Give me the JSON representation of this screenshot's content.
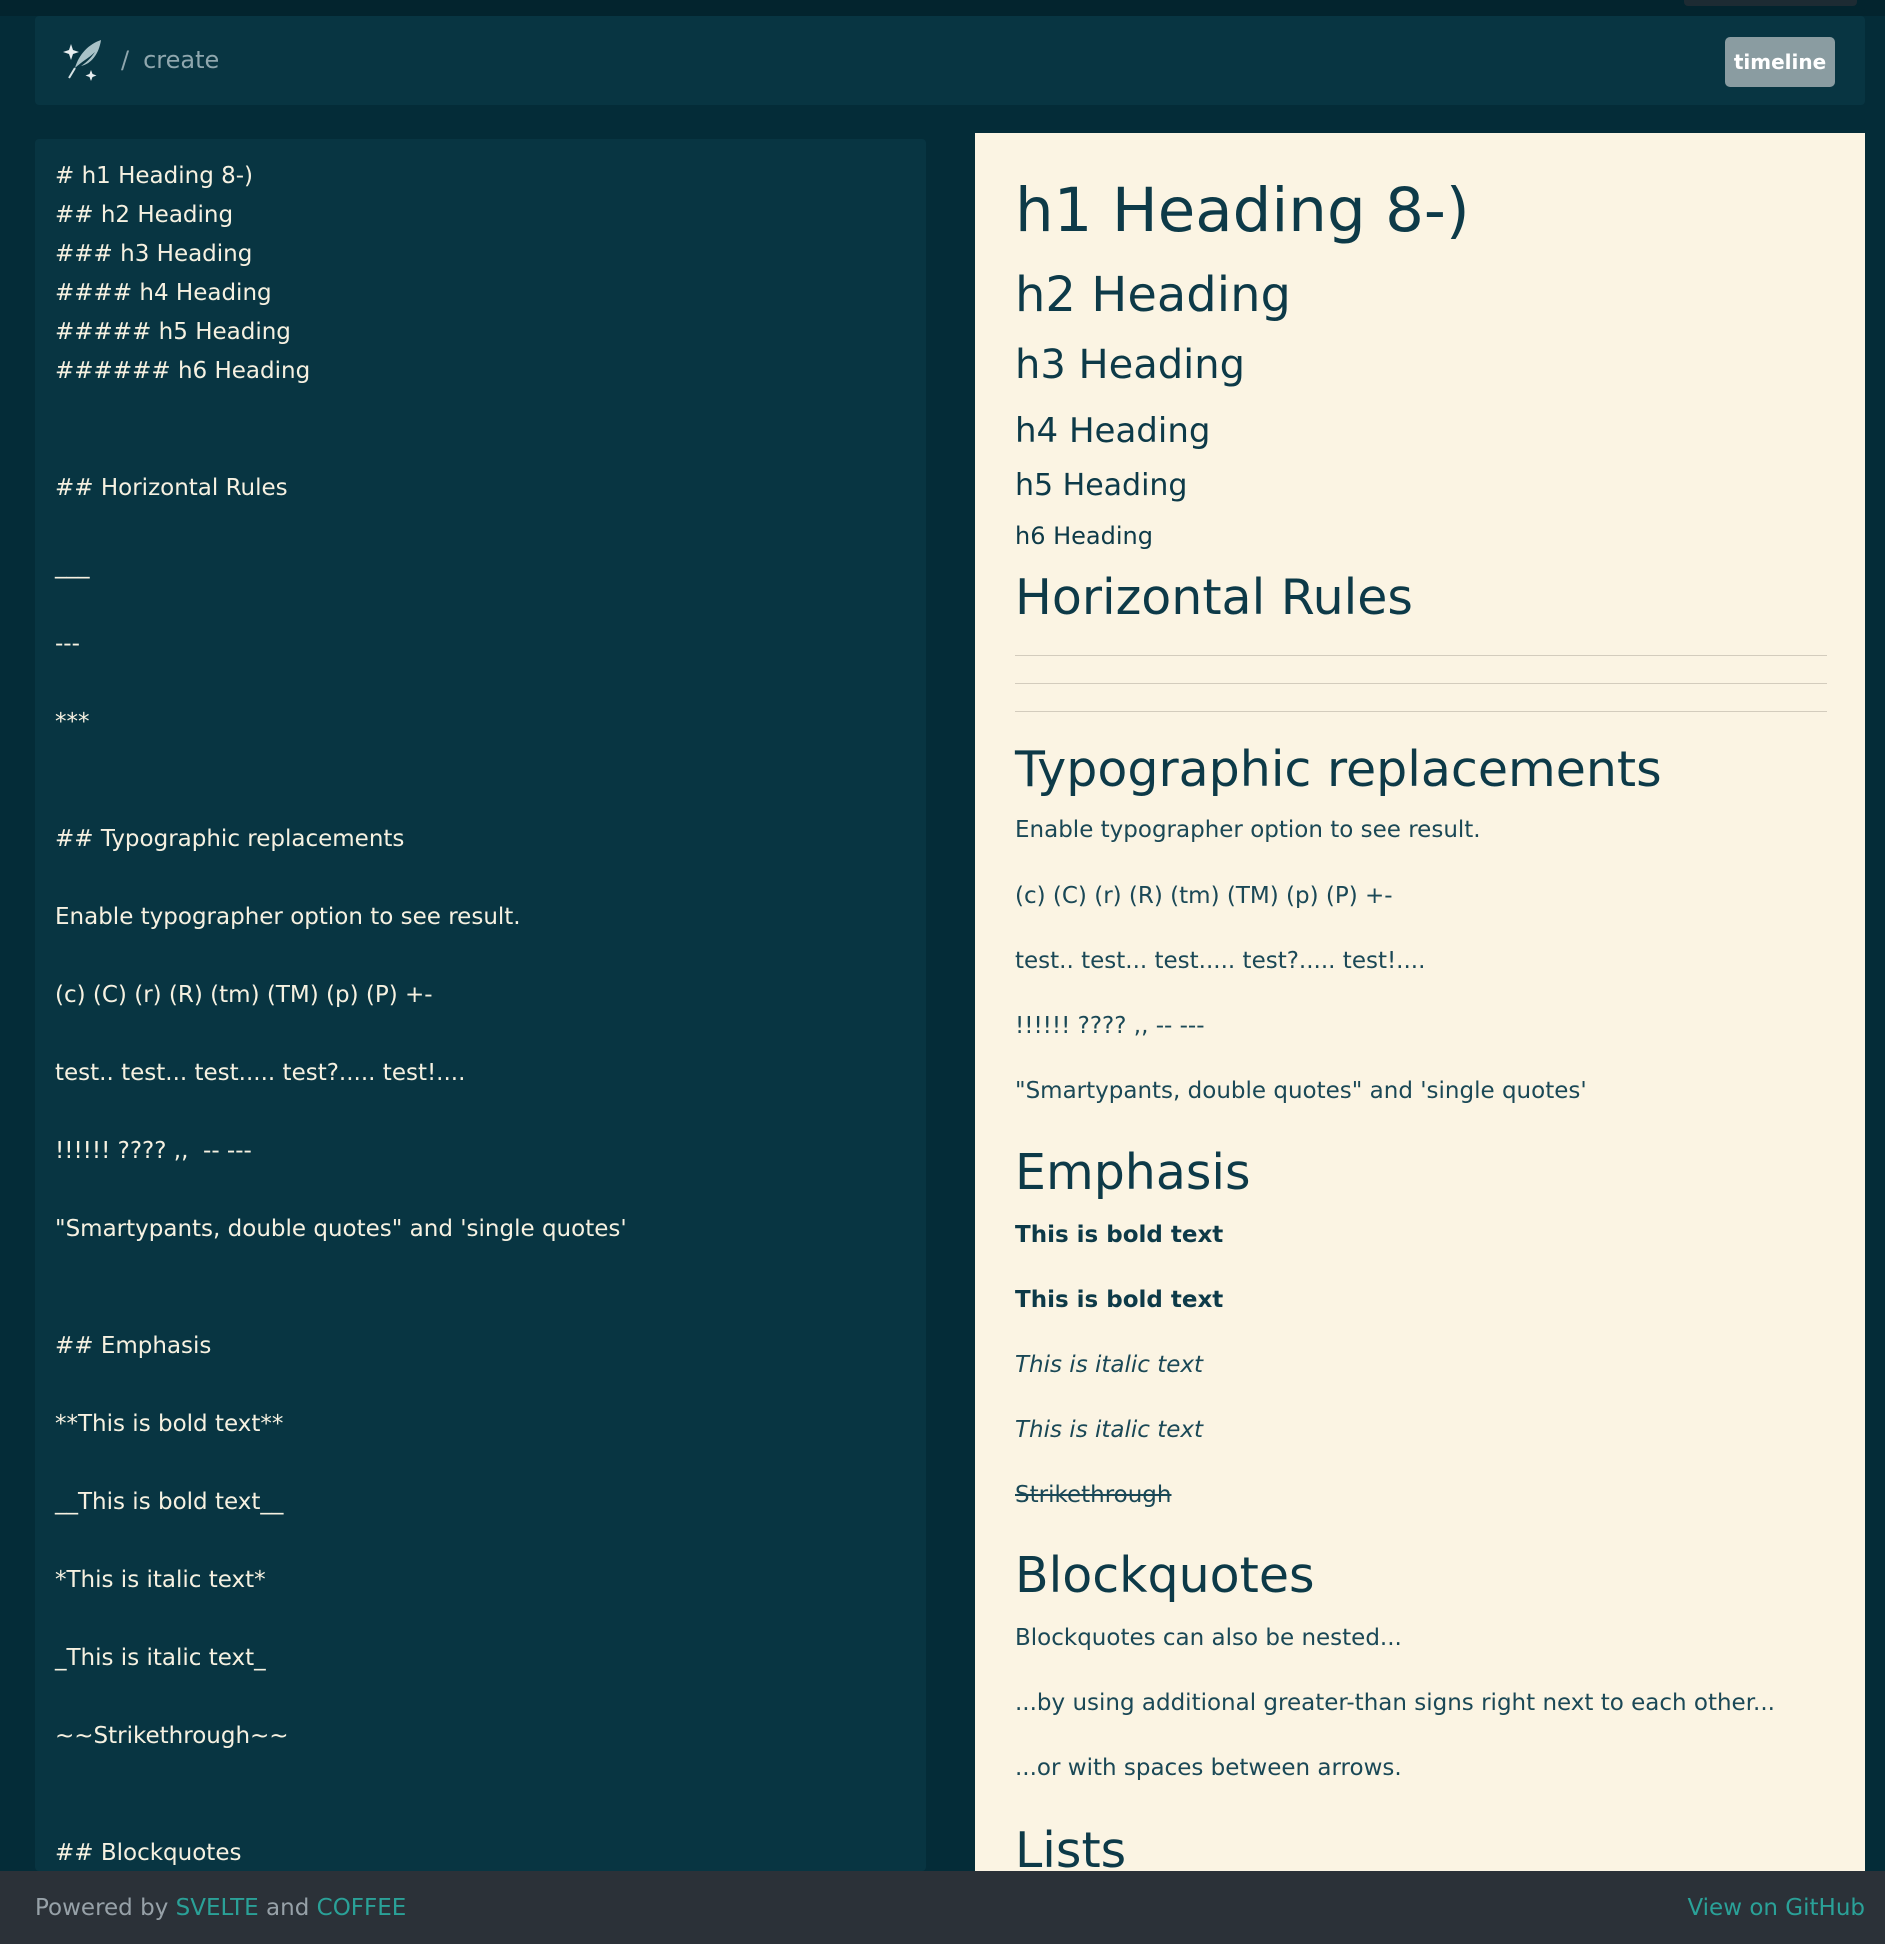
{
  "header": {
    "crumb_separator": "/",
    "crumb": "create",
    "timeline_label": "timeline",
    "logo_icon": "quill-sparkle-icon"
  },
  "editor": {
    "lines": [
      "# h1 Heading 8-)",
      "## h2 Heading",
      "### h3 Heading",
      "#### h4 Heading",
      "##### h5 Heading",
      "###### h6 Heading",
      "",
      "",
      "## Horizontal Rules",
      "",
      "___",
      "",
      "---",
      "",
      "***",
      "",
      "",
      "## Typographic replacements",
      "",
      "Enable typographer option to see result.",
      "",
      "(c) (C) (r) (R) (tm) (TM) (p) (P) +-",
      "",
      "test.. test... test..... test?..... test!....",
      "",
      "!!!!!! ???? ,,  -- ---",
      "",
      "\"Smartypants, double quotes\" and 'single quotes'",
      "",
      "",
      "## Emphasis",
      "",
      "**This is bold text**",
      "",
      "__This is bold text__",
      "",
      "*This is italic text*",
      "",
      "_This is italic text_",
      "",
      "~~Strikethrough~~",
      "",
      "",
      "## Blockquotes"
    ]
  },
  "preview": {
    "h1": "h1 Heading 8-)",
    "h2": "h2 Heading",
    "h3": "h3 Heading",
    "h4": "h4 Heading",
    "h5": "h5 Heading",
    "h6": "h6 Heading",
    "hr_title": "Horizontal Rules",
    "typo_title": "Typographic replacements",
    "typo_p1": "Enable typographer option to see result.",
    "typo_p2": "(c) (C) (r) (R) (tm) (TM) (p) (P) +-",
    "typo_p3": "test.. test... test..... test?..... test!....",
    "typo_p4": "!!!!!! ???? ,, -- ---",
    "typo_p5": "\"Smartypants, double quotes\" and 'single quotes'",
    "emph_title": "Emphasis",
    "bold1": "This is bold text",
    "bold2": "This is bold text",
    "italic1": "This is italic text",
    "italic2": "This is italic text",
    "strike": "Strikethrough",
    "bq_title": "Blockquotes",
    "bq1": "Blockquotes can also be nested...",
    "bq2": "...by using additional greater-than signs right next to each other...",
    "bq3": "...or with spaces between arrows.",
    "lists_title": "Lists"
  },
  "footer": {
    "powered_by": "Powered by ",
    "svelte": "SVELTE",
    "and": " and ",
    "coffee": "COFFEE",
    "github": "View on GitHub"
  },
  "colors": {
    "background": "#042c38",
    "panel": "#083542",
    "preview_bg": "#fbf4e3",
    "accent": "#2aa198",
    "footer_bg": "#2b3138"
  }
}
